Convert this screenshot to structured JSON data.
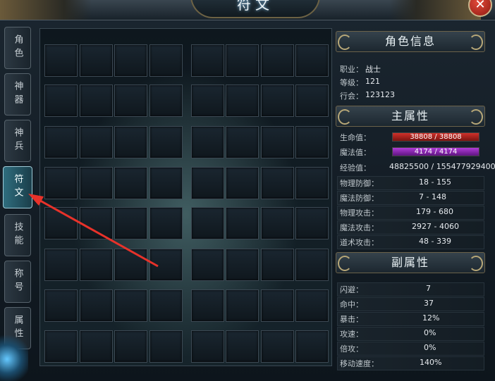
{
  "window": {
    "title": "符文",
    "close_icon": "close-icon"
  },
  "side_tabs": [
    "角色",
    "神器",
    "神兵",
    "符文",
    "技能",
    "称号",
    "属性"
  ],
  "active_tab": "符文",
  "rune_grid": {
    "rows": 8,
    "cols": 8
  },
  "character_info": {
    "header": "角色信息",
    "class_label": "职业：",
    "class_value": "战士",
    "level_label": "等级：",
    "level_value": "121",
    "guild_label": "行会：",
    "guild_value": "123123"
  },
  "main_attrs": {
    "header": "主属性",
    "hp_label": "生命值：",
    "hp_value": "38808 / 38808",
    "mp_label": "魔法值：",
    "mp_value": "4174 / 4174",
    "exp_label": "经验值：",
    "exp_value": "48825500 / 155477929400",
    "rows": [
      {
        "label": "物理防御：",
        "value": "18 - 155"
      },
      {
        "label": "魔法防御：",
        "value": "7 - 148"
      },
      {
        "label": "物理攻击：",
        "value": "179 - 680"
      },
      {
        "label": "魔法攻击：",
        "value": "2927 - 4060"
      },
      {
        "label": "道术攻击：",
        "value": "48 - 339"
      }
    ]
  },
  "sub_attrs": {
    "header": "副属性",
    "rows": [
      {
        "label": "闪避：",
        "value": "7"
      },
      {
        "label": "命中：",
        "value": "37"
      },
      {
        "label": "暴击：",
        "value": "12%"
      },
      {
        "label": "攻速：",
        "value": "0%"
      },
      {
        "label": "倍攻：",
        "value": "0%"
      },
      {
        "label": "移动速度：",
        "value": "140%"
      }
    ]
  }
}
